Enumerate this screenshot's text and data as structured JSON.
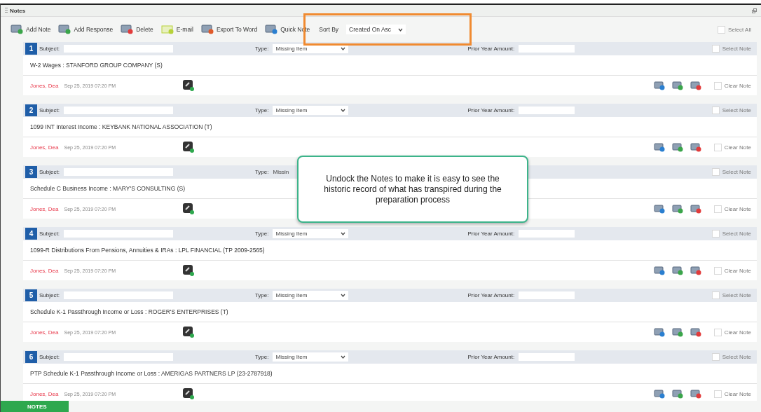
{
  "window": {
    "title": "Notes"
  },
  "toolbar": {
    "buttons": [
      {
        "kind": "add-note",
        "label": "Add Note"
      },
      {
        "kind": "add-response",
        "label": "Add Response"
      },
      {
        "kind": "delete",
        "label": "Delete"
      },
      {
        "kind": "email",
        "label": "E-mail"
      },
      {
        "kind": "export",
        "label": "Export To Word"
      },
      {
        "kind": "quick",
        "label": "Quick Note"
      }
    ],
    "sort_label": "Sort By",
    "sort_value": "Created On Asc",
    "select_all": {
      "label": "Select All",
      "checked": false
    }
  },
  "notes": [
    {
      "number": "1",
      "subject_label": "Subject:",
      "type_label": "Type:",
      "type": "Missing Item",
      "prior_label": "Prior Year Amount:",
      "select_label": "Select Note",
      "selected": false,
      "description": "W-2 Wages : STANFORD GROUP COMPANY (S)",
      "author": "Jones, Dea",
      "timestamp": "Sep 25, 2019 07:20 PM",
      "clear_label": "Clear Note",
      "clear_checked": false
    },
    {
      "number": "2",
      "subject_label": "Subject:",
      "type_label": "Type:",
      "type": "Missing Item",
      "prior_label": "Prior Year Amount:",
      "select_label": "Select Note",
      "selected": false,
      "description": "1099 INT Interest Income : KEYBANK NATIONAL ASSOCIATION (T)",
      "author": "Jones, Dea",
      "timestamp": "Sep 25, 2019 07:20 PM",
      "clear_label": "Clear Note",
      "clear_checked": false
    },
    {
      "number": "3",
      "subject_label": "Subject:",
      "type_label": "Type:",
      "type": "Missin",
      "select_label": "Select Note",
      "selected": false,
      "description": "Schedule C Business Income  : MARY'S CONSULTING (S)",
      "author": "Jones, Dea",
      "timestamp": "Sep 25, 2019 07:20 PM",
      "clear_label": "Clear Note",
      "clear_checked": false
    },
    {
      "number": "4",
      "subject_label": "Subject:",
      "type_label": "Type:",
      "type": "Missing Item",
      "prior_label": "Prior Year Amount:",
      "select_label": "Select Note",
      "selected": false,
      "description": "1099-R  Distributions From Pensions, Annuities & IRAs : LPL FINANCIAL (TP 2009-2565)",
      "author": "Jones, Dea",
      "timestamp": "Sep 25, 2019 07:20 PM",
      "clear_label": "Clear Note",
      "clear_checked": false
    },
    {
      "number": "5",
      "subject_label": "Subject:",
      "type_label": "Type:",
      "type": "Missing Item",
      "prior_label": "Prior Year Amount:",
      "select_label": "Select Note",
      "selected": false,
      "description": "Schedule K-1 Passthrough Income or Loss : ROGER'S ENTERPRISES (T)",
      "author": "Jones, Dea",
      "timestamp": "Sep 25, 2019 07:20 PM",
      "clear_label": "Clear Note",
      "clear_checked": false
    },
    {
      "number": "6",
      "subject_label": "Subject:",
      "type_label": "Type:",
      "type": "Missing Item",
      "prior_label": "Prior Year Amount:",
      "select_label": "Select Note",
      "selected": false,
      "description": "PTP Schedule K-1 Passthrough Income or Loss : AMERIGAS PARTNERS LP (23-2787918)",
      "author": "Jones, Dea",
      "timestamp": "Sep 25, 2019 07:20 PM",
      "clear_label": "Clear Note",
      "clear_checked": false
    }
  ],
  "callout": {
    "text": "Undock the Notes to make it is easy to see the historic record of what has transpired during the preparation process"
  },
  "bottom_tab": {
    "label": "NOTES",
    "selected": true
  }
}
